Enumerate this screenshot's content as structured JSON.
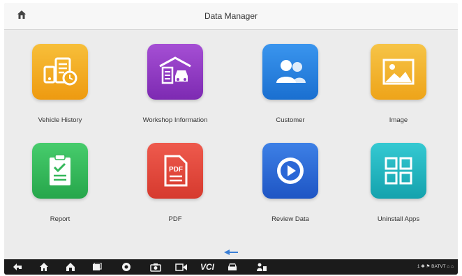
{
  "header": {
    "title": "Data Manager",
    "home_icon": "home-icon"
  },
  "apps": [
    {
      "label": "Vehicle History",
      "icon": "vehicle-history-icon",
      "color": "#f2a81d"
    },
    {
      "label": "Workshop Information",
      "icon": "workshop-info-icon",
      "color": "#8e3bc1"
    },
    {
      "label": "Customer",
      "icon": "customer-icon",
      "color": "#1f7fe0"
    },
    {
      "label": "Image",
      "icon": "image-icon",
      "color": "#f0b22a"
    },
    {
      "label": "Report",
      "icon": "report-icon",
      "color": "#34b85a"
    },
    {
      "label": "PDF",
      "icon": "pdf-icon",
      "color": "#e2463a"
    },
    {
      "label": "Review Data",
      "icon": "review-data-icon",
      "color": "#2b67d6"
    },
    {
      "label": "Uninstall Apps",
      "icon": "uninstall-apps-icon",
      "color": "#1fb6c0"
    }
  ],
  "pdf_icon_text": "PDF",
  "navbar": {
    "vci_label": "VCI",
    "status_text": "1 ✱ ⚑ BATVT ⌂ ⌂"
  }
}
